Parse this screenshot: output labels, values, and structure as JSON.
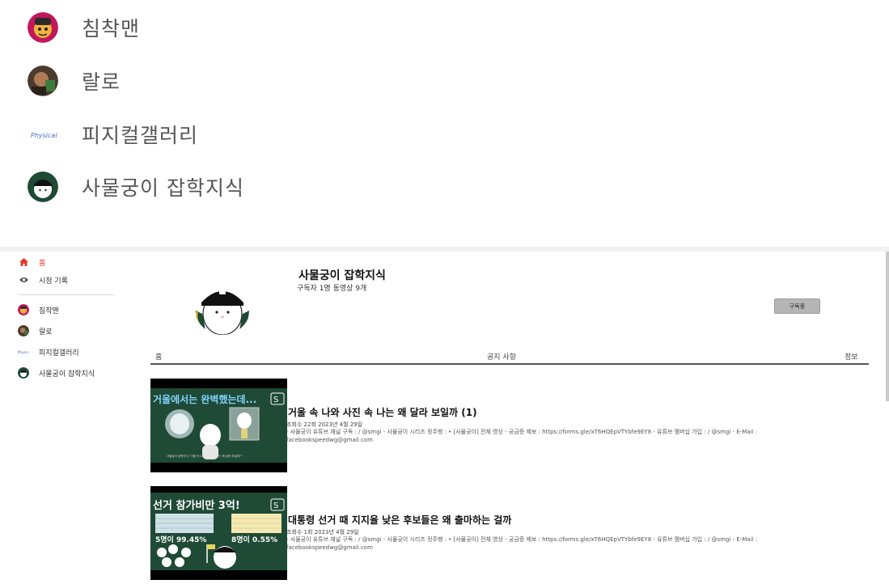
{
  "top_list": {
    "items": [
      {
        "label": "침착맨",
        "icon": "chimchakman-avatar"
      },
      {
        "label": "랄로",
        "icon": "ralo-avatar"
      },
      {
        "label": "피지컬갤러리",
        "icon": "physical-gallery-logo"
      },
      {
        "label": "사물궁이 잡학지식",
        "icon": "samulgungi-avatar"
      }
    ]
  },
  "sidebar": {
    "home_label": "홈",
    "history_label": "시청 기록",
    "subscriptions": [
      {
        "label": "침착맨"
      },
      {
        "label": "랄로"
      },
      {
        "label": "피지컬갤러리"
      },
      {
        "label": "사물궁이 잡학지식"
      }
    ]
  },
  "channel": {
    "name": "사물궁이 잡학지식",
    "stats": "구독자 1명 동영상 9개",
    "subscribe_label": "구독중"
  },
  "tabs": [
    {
      "label": "홈"
    },
    {
      "label": "공지 사항"
    },
    {
      "label": "정보"
    }
  ],
  "videos": [
    {
      "title": "거울 속 나와 사진 속 나는 왜 달라 보일까 (1)",
      "meta": "조회수 22회 2023년 4월 29일",
      "desc": "- 사물궁이 유튜브 채널 구독 : / @smgi - 사물궁이 시리즈 정주행 : • [사물궁이] 전체 영상 - 궁금증 제보 : https://forms.gle/xT6HQEpVTYbfe9EY8 - 유튜브 멤버십 가입 : / @smgi - E-Mail : facebookspeedwg@gmail.com",
      "thumb_text": "거울에서는 완벽했는데...",
      "thumb_caption": "사물궁이 잡학지식 \"거울 속 나와 사진 속 나는 왜 달라 보일까?\""
    },
    {
      "title": "대통령 선거 때 지지율 낮은 후보들은 왜 출마하는 걸까",
      "meta": "조회수 1회 2023년 4월 29일",
      "desc": "- 사물궁이 유튜브 채널 구독 : / @smgi - 사물궁이 시리즈 정주행 : • [사물궁이] 전체 영상 - 궁금증 제보 : https://forms.gle/xT6HQEpVTYbfe9EY8 - 유튜브 멤버십 가입 : / @smgi - E-Mail : facebookspeedwg@gmail.com",
      "thumb_text": "선거 참가비만 3억!",
      "thumb_left": "5명이 99.45%",
      "thumb_right": "8명이 0.55%"
    }
  ],
  "colors": {
    "accent": "#e03a2f",
    "thumb_green": "#1f4a35",
    "thumb_title": "#7fd3ff"
  }
}
